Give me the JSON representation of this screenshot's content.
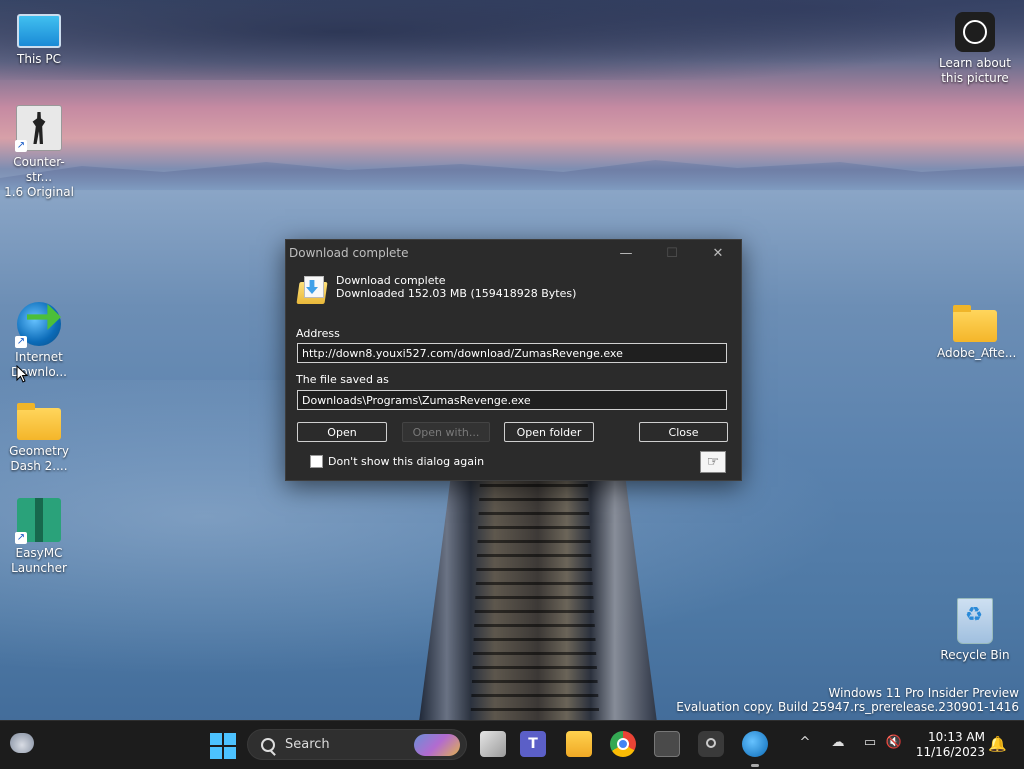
{
  "desktop": {
    "icons": [
      {
        "label_line1": "This PC",
        "label_line2": ""
      },
      {
        "label_line1": "Counter-str...",
        "label_line2": "1.6 Original"
      },
      {
        "label_line1": "Internet",
        "label_line2": "Downlo..."
      },
      {
        "label_line1": "Geometry",
        "label_line2": "Dash 2...."
      },
      {
        "label_line1": "EasyMC",
        "label_line2": "Launcher"
      },
      {
        "label_line1": "Learn about",
        "label_line2": "this picture"
      },
      {
        "label_line1": "Adobe_Afte...",
        "label_line2": ""
      },
      {
        "label_line1": "Recycle Bin",
        "label_line2": ""
      }
    ],
    "watermark": {
      "line1": "Windows 11 Pro Insider Preview",
      "line2": "Evaluation copy. Build 25947.rs_prerelease.230901-1416"
    }
  },
  "dialog": {
    "title": "Download complete",
    "heading": "Download complete",
    "subheading": "Downloaded 152.03  MB (159418928 Bytes)",
    "address_label": "Address",
    "address_value": "http://down8.youxi527.com/download/ZumasRevenge.exe",
    "saved_label": "The file saved as",
    "saved_value": "Downloads\\Programs\\ZumasRevenge.exe",
    "buttons": {
      "open": "Open",
      "open_with": "Open with...",
      "open_folder": "Open folder",
      "close": "Close"
    },
    "checkbox_label": "Don't show this dialog again",
    "checkbox_checked": false,
    "titlebar_controls": {
      "minimize": "—",
      "maximize": "☐",
      "close": "✕"
    }
  },
  "taskbar": {
    "search_label": "Search",
    "tray_chevron": "^",
    "time": "10:13 AM",
    "date": "11/16/2023",
    "teams_letter": "T"
  }
}
